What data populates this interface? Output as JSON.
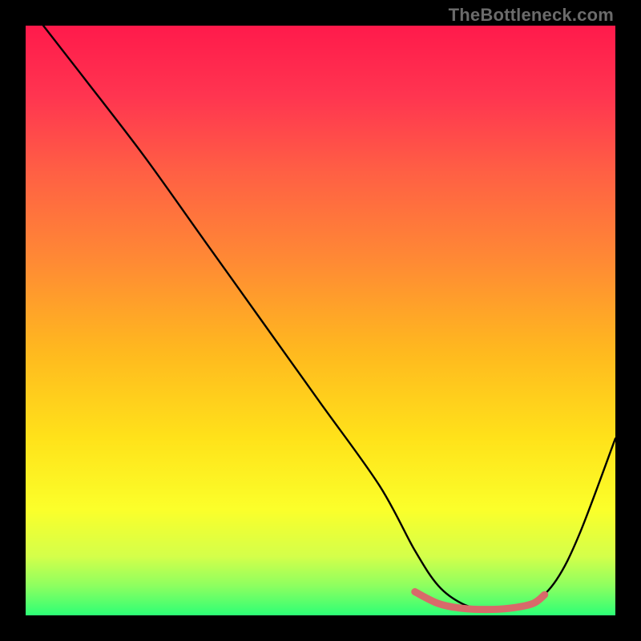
{
  "watermark": "TheBottleneck.com",
  "chart_data": {
    "type": "line",
    "title": "",
    "xlabel": "",
    "ylabel": "",
    "xlim": [
      0,
      100
    ],
    "ylim": [
      0,
      100
    ],
    "grid": false,
    "legend": false,
    "annotations": [],
    "series": [
      {
        "name": "main-curve",
        "color": "#000000",
        "x": [
          3,
          10,
          20,
          30,
          40,
          50,
          60,
          66,
          70,
          74,
          78,
          82,
          86,
          90,
          94,
          100
        ],
        "y": [
          100,
          91,
          78,
          64,
          50,
          36,
          22,
          11,
          5,
          2,
          1,
          1,
          2,
          6,
          14,
          30
        ]
      },
      {
        "name": "highlight-band",
        "color": "#d86a6a",
        "x": [
          66,
          70,
          74,
          78,
          82,
          86,
          88
        ],
        "y": [
          4,
          2,
          1.2,
          1,
          1.2,
          2,
          3.5
        ]
      }
    ],
    "background_gradient": {
      "type": "vertical",
      "stops": [
        {
          "pos": 0.0,
          "color": "#ff1a4b"
        },
        {
          "pos": 0.12,
          "color": "#ff3550"
        },
        {
          "pos": 0.25,
          "color": "#ff6044"
        },
        {
          "pos": 0.4,
          "color": "#ff8a34"
        },
        {
          "pos": 0.55,
          "color": "#ffb81f"
        },
        {
          "pos": 0.7,
          "color": "#ffe21a"
        },
        {
          "pos": 0.82,
          "color": "#fbff2a"
        },
        {
          "pos": 0.9,
          "color": "#d4ff4a"
        },
        {
          "pos": 0.95,
          "color": "#8dff60"
        },
        {
          "pos": 1.0,
          "color": "#2dff76"
        }
      ]
    }
  }
}
